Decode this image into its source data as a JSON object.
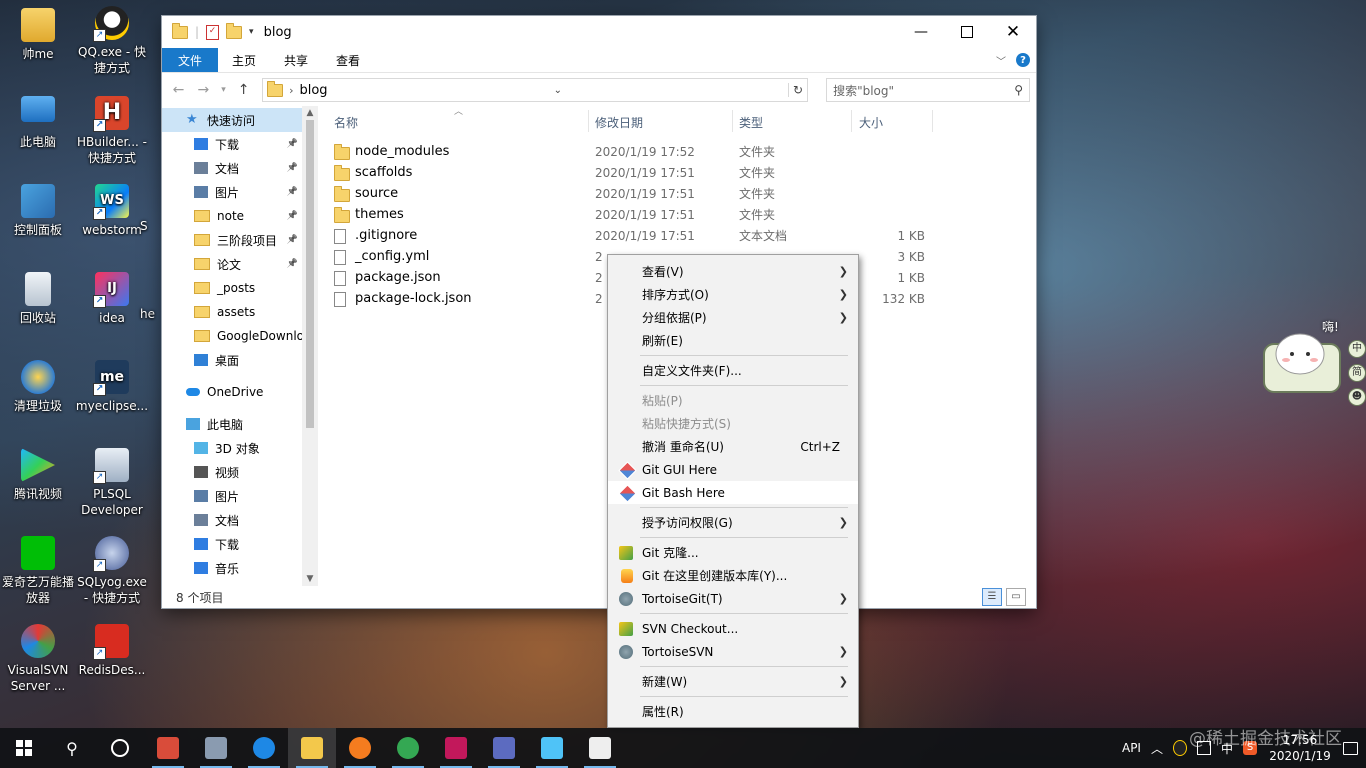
{
  "desktop": {
    "icons": [
      {
        "label": "帅me",
        "icon": "user-folder-icon"
      },
      {
        "label": "QQ.exe - 快捷方式",
        "icon": "qq-icon"
      },
      {
        "label": "此电脑",
        "icon": "computer-icon"
      },
      {
        "label": "HBuilder... - 快捷方式",
        "icon": "hbuilder-icon"
      },
      {
        "label": "控制面板",
        "icon": "control-panel-icon"
      },
      {
        "label": "webstorm",
        "icon": "webstorm-icon"
      },
      {
        "label": "回收站",
        "icon": "recycle-bin-icon"
      },
      {
        "label": "idea",
        "icon": "intellij-idea-icon"
      },
      {
        "label": "清理垃圾",
        "icon": "cleanup-icon"
      },
      {
        "label": "myeclipse...",
        "icon": "myeclipse-icon"
      },
      {
        "label": "腾讯视频",
        "icon": "tencent-video-icon"
      },
      {
        "label": "PLSQL Developer",
        "icon": "plsql-icon"
      },
      {
        "label": "爱奇艺万能播放器",
        "icon": "iqiyi-player-icon"
      },
      {
        "label": "SQLyog.exe - 快捷方式",
        "icon": "sqlyog-icon"
      },
      {
        "label": "VisualSVN Server ...",
        "icon": "visualsvn-icon"
      },
      {
        "label": "RedisDes...",
        "icon": "redis-desktop-icon"
      }
    ],
    "partial_labels": {
      "s": "S",
      "he": "he"
    }
  },
  "explorer": {
    "title": "blog",
    "ribbon_tabs": [
      "文件",
      "主页",
      "共享",
      "查看"
    ],
    "address_path": "blog",
    "search_placeholder": "搜索\"blog\"",
    "columns": {
      "name": "名称",
      "date": "修改日期",
      "type": "类型",
      "size": "大小"
    },
    "nav": [
      {
        "label": "快速访问",
        "icon": "star-icon",
        "pinned": false,
        "active": true,
        "indent": 0
      },
      {
        "label": "下载",
        "icon": "download-icon",
        "pinned": true,
        "indent": 1
      },
      {
        "label": "文档",
        "icon": "document-icon",
        "pinned": true,
        "indent": 1
      },
      {
        "label": "图片",
        "icon": "picture-icon",
        "pinned": true,
        "indent": 1
      },
      {
        "label": "note",
        "icon": "folder-icon",
        "pinned": true,
        "indent": 1
      },
      {
        "label": "三阶段项目",
        "icon": "folder-icon",
        "pinned": true,
        "indent": 1
      },
      {
        "label": "论文",
        "icon": "folder-icon",
        "pinned": true,
        "indent": 1
      },
      {
        "label": "_posts",
        "icon": "folder-icon",
        "pinned": false,
        "indent": 1
      },
      {
        "label": "assets",
        "icon": "folder-icon",
        "pinned": false,
        "indent": 1
      },
      {
        "label": "GoogleDownlo",
        "icon": "folder-icon",
        "pinned": false,
        "indent": 1
      },
      {
        "label": "桌面",
        "icon": "desktop-icon",
        "pinned": false,
        "indent": 1
      },
      {
        "label": "OneDrive",
        "icon": "onedrive-icon",
        "pinned": false,
        "indent": 0,
        "gap": true
      },
      {
        "label": "此电脑",
        "icon": "computer-icon",
        "pinned": false,
        "indent": 0,
        "gap": true
      },
      {
        "label": "3D 对象",
        "icon": "3d-objects-icon",
        "pinned": false,
        "indent": 1
      },
      {
        "label": "视频",
        "icon": "video-icon",
        "pinned": false,
        "indent": 1
      },
      {
        "label": "图片",
        "icon": "picture-icon",
        "pinned": false,
        "indent": 1
      },
      {
        "label": "文档",
        "icon": "document-icon",
        "pinned": false,
        "indent": 1
      },
      {
        "label": "下载",
        "icon": "download-icon",
        "pinned": false,
        "indent": 1
      },
      {
        "label": "音乐",
        "icon": "music-icon",
        "pinned": false,
        "indent": 1
      }
    ],
    "files": [
      {
        "name": "node_modules",
        "date": "2020/1/19 17:52",
        "type": "文件夹",
        "size": "",
        "kind": "folder"
      },
      {
        "name": "scaffolds",
        "date": "2020/1/19 17:51",
        "type": "文件夹",
        "size": "",
        "kind": "folder"
      },
      {
        "name": "source",
        "date": "2020/1/19 17:51",
        "type": "文件夹",
        "size": "",
        "kind": "folder"
      },
      {
        "name": "themes",
        "date": "2020/1/19 17:51",
        "type": "文件夹",
        "size": "",
        "kind": "folder"
      },
      {
        "name": ".gitignore",
        "date": "2020/1/19 17:51",
        "type": "文本文档",
        "size": "1 KB",
        "kind": "file"
      },
      {
        "name": "_config.yml",
        "date": "2",
        "type": "",
        "size": "3 KB",
        "kind": "file"
      },
      {
        "name": "package.json",
        "date": "2",
        "type": "",
        "size": "1 KB",
        "kind": "file"
      },
      {
        "name": "package-lock.json",
        "date": "2",
        "type": "",
        "size": "132 KB",
        "kind": "file"
      }
    ],
    "status": "8 个项目"
  },
  "context_menu": {
    "items": [
      {
        "label": "查看(V)",
        "submenu": true
      },
      {
        "label": "排序方式(O)",
        "submenu": true
      },
      {
        "label": "分组依据(P)",
        "submenu": true
      },
      {
        "label": "刷新(E)"
      },
      {
        "sep": true
      },
      {
        "label": "自定义文件夹(F)..."
      },
      {
        "sep": true
      },
      {
        "label": "粘贴(P)",
        "disabled": true
      },
      {
        "label": "粘贴快捷方式(S)",
        "disabled": true
      },
      {
        "label": "撤消 重命名(U)",
        "shortcut": "Ctrl+Z"
      },
      {
        "label": "Git GUI Here",
        "icon": "git-icon"
      },
      {
        "label": "Git Bash Here",
        "icon": "git-icon",
        "hover": true
      },
      {
        "sep": true
      },
      {
        "label": "授予访问权限(G)",
        "submenu": true
      },
      {
        "sep": true
      },
      {
        "label": "Git 克隆...",
        "icon": "tortoisegit-clone-icon"
      },
      {
        "label": "Git 在这里创建版本库(Y)...",
        "icon": "tortoisegit-create-repo-icon"
      },
      {
        "label": "TortoiseGit(T)",
        "icon": "tortoisegit-icon",
        "submenu": true
      },
      {
        "sep": true
      },
      {
        "label": "SVN Checkout...",
        "icon": "svn-checkout-icon"
      },
      {
        "label": "TortoiseSVN",
        "icon": "tortoisesvn-icon",
        "submenu": true
      },
      {
        "sep": true
      },
      {
        "label": "新建(W)",
        "submenu": true
      },
      {
        "sep": true
      },
      {
        "label": "属性(R)"
      }
    ]
  },
  "mascot": {
    "speech": "嗨!",
    "badges": [
      "中",
      "简",
      "☻"
    ]
  },
  "taskbar": {
    "apps": [
      {
        "name": "tool-icon",
        "color": "#d94c3a"
      },
      {
        "name": "remote-desktop-icon",
        "color": "#8a9bb0"
      },
      {
        "name": "edge-icon",
        "color": "#1e88e5"
      },
      {
        "name": "file-explorer-icon",
        "color": "#f3c84b",
        "active": true
      },
      {
        "name": "firefox-icon",
        "color": "#f57c1f"
      },
      {
        "name": "chrome-icon",
        "color": "#34a853"
      },
      {
        "name": "intellij-idea-icon",
        "color": "#c2185b"
      },
      {
        "name": "xshell-icon",
        "color": "#5c6bc0"
      },
      {
        "name": "paint-icon",
        "color": "#4fc3f7"
      },
      {
        "name": "typora-icon",
        "color": "#eeeeee"
      }
    ],
    "tray_text": "API",
    "ime": "中",
    "time": "17:56",
    "date": "2020/1/19"
  },
  "watermark": "@稀土掘金技术社区"
}
